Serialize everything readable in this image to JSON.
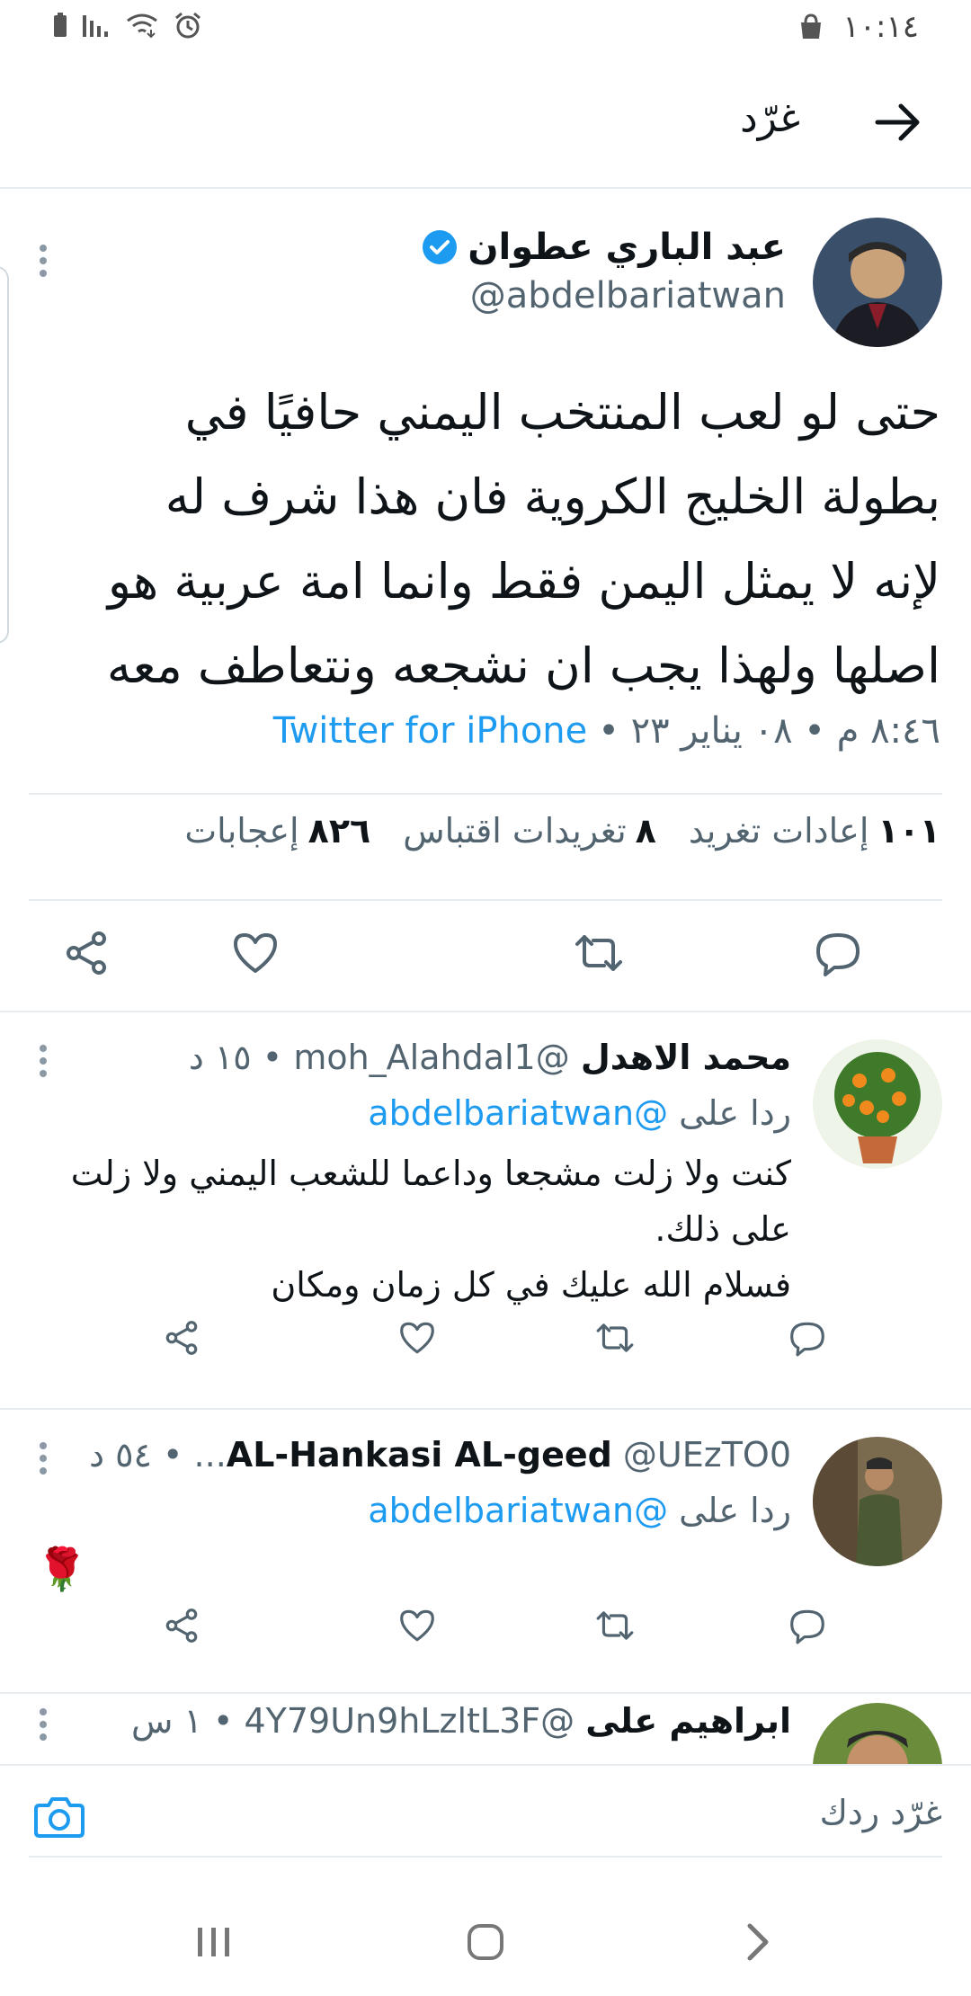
{
  "status_bar": {
    "time": "١٠:١٤",
    "icons": [
      "battery-icon",
      "signal-icon",
      "wifi-icon",
      "alarm-icon",
      "bag-icon"
    ]
  },
  "app_bar": {
    "title": "غرّد",
    "back_icon": "arrow-right-icon"
  },
  "main_tweet": {
    "author_name": "عبد الباري عطوان",
    "handle": "@abdelbariatwan",
    "text_lines": [
      "حتى لو لعب المنتخب اليمني حافيًا في",
      "بطولة الخليج الكروية فان هذا شرف له",
      "لإنه لا يمثل اليمن فقط وانما امة عربية هو",
      "اصلها ولهذا يجب ان نشجعه ونتعاطف معه"
    ],
    "timestamp": "٨:٤٦ م • ٠٨ يناير ٢٣ •",
    "source": "Twitter for iPhone",
    "stats": {
      "retweets_count": "١٠١",
      "retweets_label": "إعادات تغريد",
      "quotes_count": "٨",
      "quotes_label": "تغريدات اقتباس",
      "likes_count": "٨٢٦",
      "likes_label": "إعجابات"
    }
  },
  "replies": [
    {
      "name": "محمد الاهدل",
      "handle": "@moh_Alahdal1",
      "time": "• ١٥ د",
      "replying_prefix": "ردا على",
      "replying_to": "@abdelbariatwan",
      "text_lines": [
        "كنت ولا زلت مشجعا وداعما للشعب اليمني ولا زلت",
        "على ذلك.",
        "فسلام الله عليك في كل زمان ومكان"
      ]
    },
    {
      "name": "AL-Hankasi AL-geed",
      "handle": "@UEzTO0...",
      "time": "• ٥٤ د",
      "replying_prefix": "ردا على",
      "replying_to": "@abdelbariatwan",
      "emoji": "🌹"
    },
    {
      "name": "ابراهيم على",
      "handle": "@4Y79Un9hLzltL3F",
      "time": "• ١ س"
    }
  ],
  "composer": {
    "placeholder": "غرّد ردك"
  },
  "colors": {
    "accent": "#1d9bf0",
    "secondary_text": "#536471",
    "divider": "#e6ecf0"
  }
}
